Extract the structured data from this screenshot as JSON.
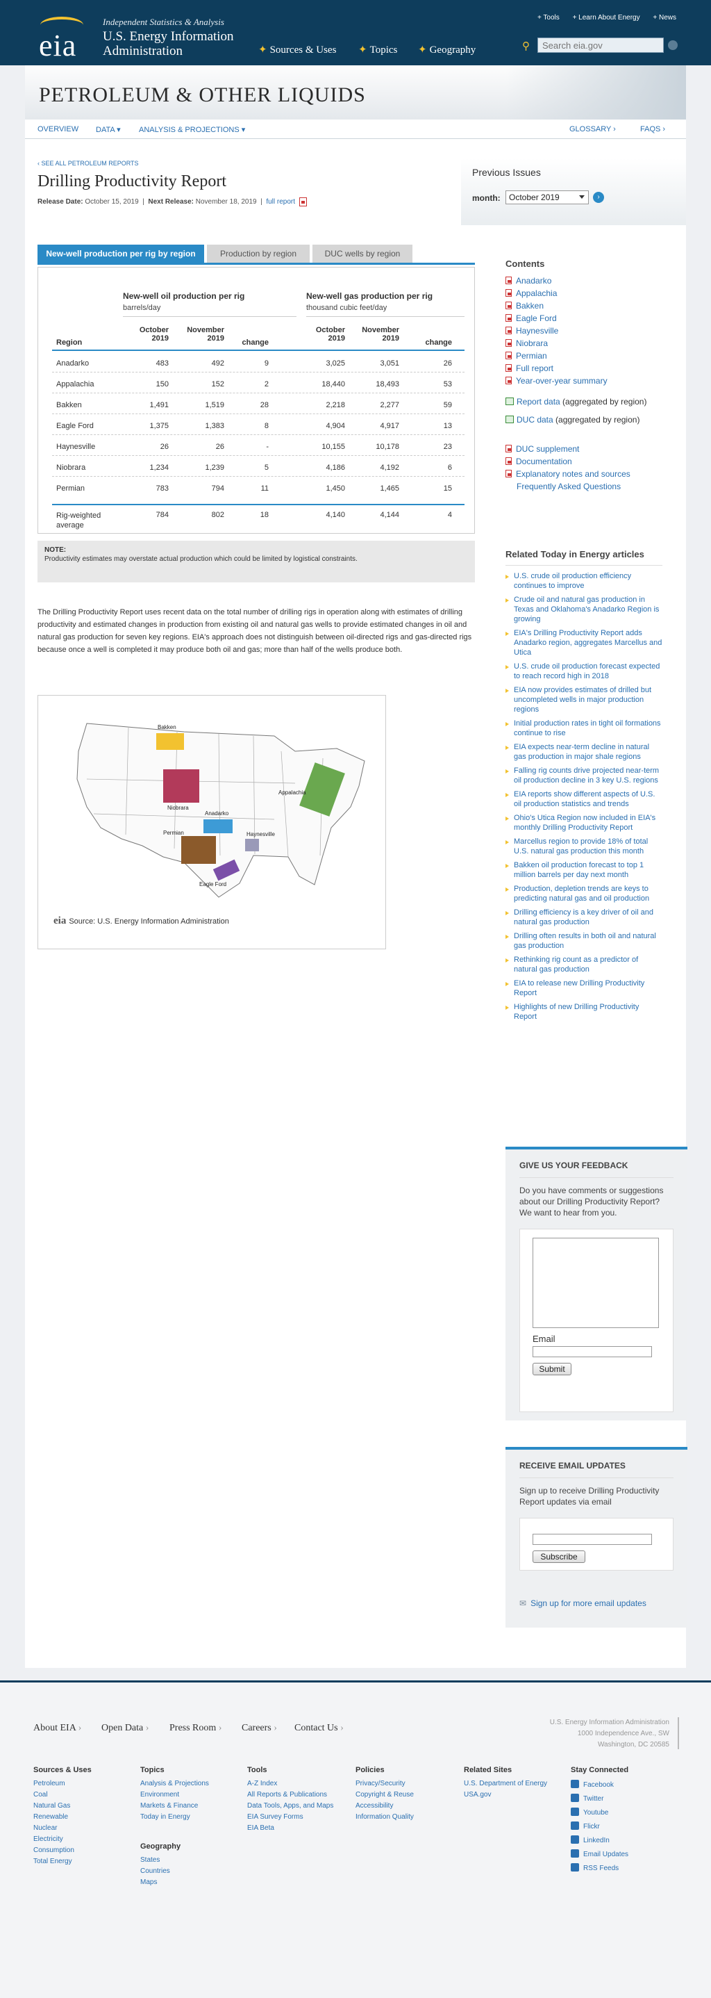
{
  "header": {
    "logo_text": "eia",
    "tagline": "Independent Statistics & Analysis",
    "agency": "U.S. Energy Information Administration",
    "links": [
      "+ Tools",
      "+ Learn About Energy",
      "+ News"
    ],
    "nav": [
      "Sources & Uses",
      "Topics",
      "Geography"
    ],
    "search_placeholder": "Search eia.gov"
  },
  "banner": {
    "title": "PETROLEUM & OTHER LIQUIDS"
  },
  "subnav": {
    "items": [
      "OVERVIEW",
      "DATA ▾",
      "ANALYSIS & PROJECTIONS ▾"
    ],
    "right": [
      "GLOSSARY ›",
      "FAQS ›"
    ]
  },
  "report": {
    "see_all": "‹ SEE ALL PETROLEUM REPORTS",
    "title": "Drilling Productivity Report",
    "release_label": "Release Date:",
    "release_date": "October 15, 2019",
    "next_label": "Next Release:",
    "next_date": "November 18, 2019",
    "full_report": "full report"
  },
  "previous": {
    "title": "Previous Issues",
    "month_label": "month:",
    "month_value": "October 2019"
  },
  "tabs": [
    "New-well production per rig by region",
    "Production by region",
    "DUC wells by region"
  ],
  "table": {
    "oil_title": "New-well oil production per rig",
    "oil_unit": "barrels/day",
    "gas_title": "New-well gas production per rig",
    "gas_unit": "thousand cubic feet/day",
    "columns": {
      "region": "Region",
      "oct": [
        "October",
        "2019"
      ],
      "nov": [
        "November",
        "2019"
      ],
      "change": "change"
    },
    "rows": [
      [
        "Anadarko",
        "483",
        "492",
        "9",
        "3,025",
        "3,051",
        "26"
      ],
      [
        "Appalachia",
        "150",
        "152",
        "2",
        "18,440",
        "18,493",
        "53"
      ],
      [
        "Bakken",
        "1,491",
        "1,519",
        "28",
        "2,218",
        "2,277",
        "59"
      ],
      [
        "Eagle Ford",
        "1,375",
        "1,383",
        "8",
        "4,904",
        "4,917",
        "13"
      ],
      [
        "Haynesville",
        "26",
        "26",
        "-",
        "10,155",
        "10,178",
        "23"
      ],
      [
        "Niobrara",
        "1,234",
        "1,239",
        "5",
        "4,186",
        "4,192",
        "6"
      ],
      [
        "Permian",
        "783",
        "794",
        "11",
        "1,450",
        "1,465",
        "15"
      ]
    ],
    "total": [
      "Rig-weighted",
      "average",
      "784",
      "802",
      "18",
      "4,140",
      "4,144",
      "4"
    ]
  },
  "note": {
    "title": "NOTE:",
    "body": "Productivity estimates may overstate actual production which could be limited by logistical constraints."
  },
  "intro": "The Drilling Productivity Report uses recent data on the total number of drilling rigs in operation along with estimates of drilling productivity and estimated changes in production from existing oil and natural gas wells to provide estimated changes in oil and natural gas production for seven key regions. EIA's approach does not distinguish between oil-directed rigs and gas-directed rigs because once a well is completed it may produce both oil and gas; more than half of the wells produce both.",
  "map": {
    "labels": [
      "Bakken",
      "Niobrara",
      "Appalachia",
      "Anadarko",
      "Permian",
      "Haynesville",
      "Eagle Ford"
    ],
    "source_logo": "eia",
    "source": "Source: U.S. Energy Information Administration",
    "colors": {
      "bakken": "#f2c230",
      "niobrara": "#b23a5a",
      "appalachia": "#6aa84f",
      "anadarko": "#3d9bd6",
      "permian": "#8b5a2b",
      "haynesville": "#9a9ab8",
      "eagleford": "#7b4fa8"
    }
  },
  "contents": {
    "title": "Contents",
    "items": [
      "Anadarko",
      "Appalachia",
      "Bakken",
      "Eagle Ford",
      "Haynesville",
      "Niobrara",
      "Permian",
      "Full report",
      "Year-over-year summary"
    ],
    "data_items": [
      {
        "link": "Report data",
        "rest": " (aggregated by region)"
      },
      {
        "link": "DUC data",
        "rest": " (aggregated by region)"
      }
    ],
    "extra": [
      "DUC supplement",
      "Documentation",
      "Explanatory notes and sources",
      "Frequently Asked Questions"
    ]
  },
  "related": {
    "title": "Related Today in Energy articles",
    "items": [
      "U.S. crude oil production efficiency continues to improve",
      "Crude oil and natural gas production in Texas and Oklahoma's Anadarko Region is growing",
      "EIA's Drilling Productivity Report adds Anadarko region, aggregates Marcellus and Utica",
      "U.S. crude oil production forecast expected to reach record high in 2018",
      "EIA now provides estimates of drilled but uncompleted wells in major production regions",
      "Initial production rates in tight oil formations continue to rise",
      "EIA expects near-term decline in natural gas production in major shale regions",
      "Falling rig counts drive projected near-term oil production decline in 3 key U.S. regions",
      "EIA reports show different aspects of U.S. oil production statistics and trends",
      "Ohio's Utica Region now included in EIA's monthly Drilling Productivity Report",
      "Marcellus region to provide 18% of total U.S. natural gas production this month",
      "Bakken oil production forecast to top 1 million barrels per day next month",
      "Production, depletion trends are keys to predicting natural gas and oil production",
      "Drilling efficiency is a key driver of oil and natural gas production",
      "Drilling often results in both oil and natural gas production",
      "Rethinking rig count as a predictor of natural gas production",
      "EIA to release new Drilling Productivity Report",
      "Highlights of new Drilling Productivity Report"
    ]
  },
  "feedback": {
    "title": "GIVE US YOUR FEEDBACK",
    "text": "Do you have comments or suggestions about our Drilling Productivity Report? We want to hear from you.",
    "email_label": "Email",
    "submit": "Submit"
  },
  "email_updates": {
    "title": "RECEIVE EMAIL UPDATES",
    "text": "Sign up to receive Drilling Productivity Report updates via email",
    "subscribe": "Subscribe",
    "more": "Sign up for more email updates"
  },
  "footer": {
    "nav": [
      "About EIA",
      "Open Data",
      "Press Room",
      "Careers",
      "Contact Us"
    ],
    "address": [
      "U.S. Energy Information Administration",
      "1000 Independence Ave., SW",
      "Washington, DC 20585"
    ],
    "cols": [
      {
        "h": "Sources & Uses",
        "items": [
          "Petroleum",
          "Coal",
          "Natural Gas",
          "Renewable",
          "Nuclear",
          "Electricity",
          "Consumption",
          "Total Energy"
        ]
      },
      {
        "h": "Topics",
        "items": [
          "Analysis & Projections",
          "Environment",
          "Markets & Finance",
          "Today in Energy"
        ]
      },
      {
        "h": "Tools",
        "items": [
          "A-Z Index",
          "All Reports & Publications",
          "Data Tools, Apps, and Maps",
          "EIA Survey Forms",
          "EIA Beta"
        ]
      },
      {
        "h": "Policies",
        "items": [
          "Privacy/Security",
          "Copyright & Reuse",
          "Accessibility",
          "Information Quality"
        ]
      },
      {
        "h": "Related Sites",
        "items": [
          "U.S. Department of Energy",
          "USA.gov"
        ]
      }
    ],
    "geo": {
      "h": "Geography",
      "items": [
        "States",
        "Countries",
        "Maps"
      ]
    },
    "social": {
      "h": "Stay Connected",
      "items": [
        "Facebook",
        "Twitter",
        "Youtube",
        "Flickr",
        "LinkedIn",
        "Email Updates",
        "RSS Feeds"
      ]
    }
  }
}
